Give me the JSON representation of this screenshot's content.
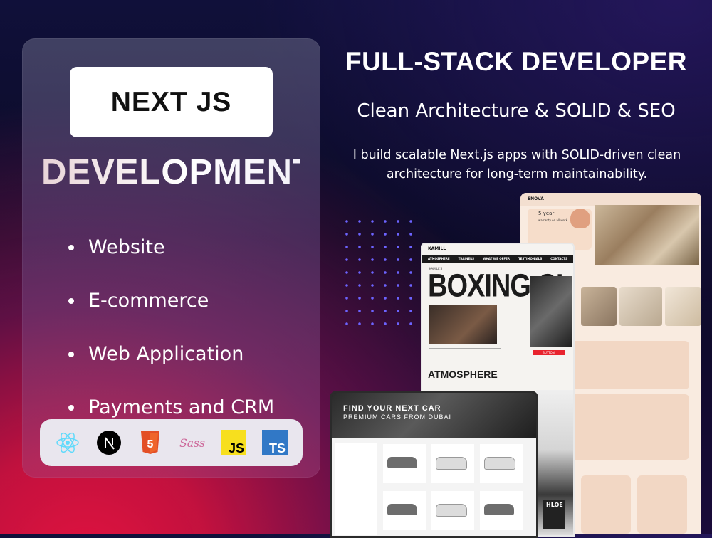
{
  "left_card": {
    "badge": "NEXT JS",
    "heading": "DEVELOPMENT",
    "services": [
      "Website",
      "E-commerce",
      "Web Application",
      "Payments and CRM"
    ],
    "tech": [
      {
        "icon": "react-icon",
        "color": "#61dafb"
      },
      {
        "icon": "nextjs-icon",
        "color": "#000000"
      },
      {
        "icon": "html5-icon",
        "color": "#e34f26",
        "label": "5"
      },
      {
        "icon": "sass-icon",
        "color": "#cd6799",
        "label": "Sass"
      },
      {
        "icon": "javascript-icon",
        "color": "#f7df1e",
        "label": "JS"
      },
      {
        "icon": "typescript-icon",
        "color": "#3178c6",
        "label": "TS"
      }
    ]
  },
  "right": {
    "title": "FULL-STACK DEVELOPER",
    "subtitle": "Clean Architecture & SOLID & SEO",
    "description_line1": "I build scalable Next.js apps with SOLID-driven clean",
    "description_line2": "architecture for long-term maintainability."
  },
  "mockups": {
    "nova": {
      "logo": "ENOVA",
      "warranty_years": "5 year",
      "warranty_text": "warranty on all work"
    },
    "boxing": {
      "logo": "KAMILL",
      "nav": [
        "ATMOSPHERE",
        "TRAINERS",
        "WHAT WE OFFER",
        "TESTIMONIALS",
        "CONTACTS"
      ],
      "kicker": "KAMILL'S",
      "title": "BOXING CLUB",
      "section": "ATMOSPHERE",
      "button": "BUTTON",
      "bottom_label": "HLOE"
    },
    "car": {
      "title": "FIND YOUR NEXT CAR",
      "subtitle": "PREMIUM CARS FROM DUBAI"
    }
  },
  "colors": {
    "accent_red": "#e0123f",
    "dot_purple": "#6c63ff"
  }
}
